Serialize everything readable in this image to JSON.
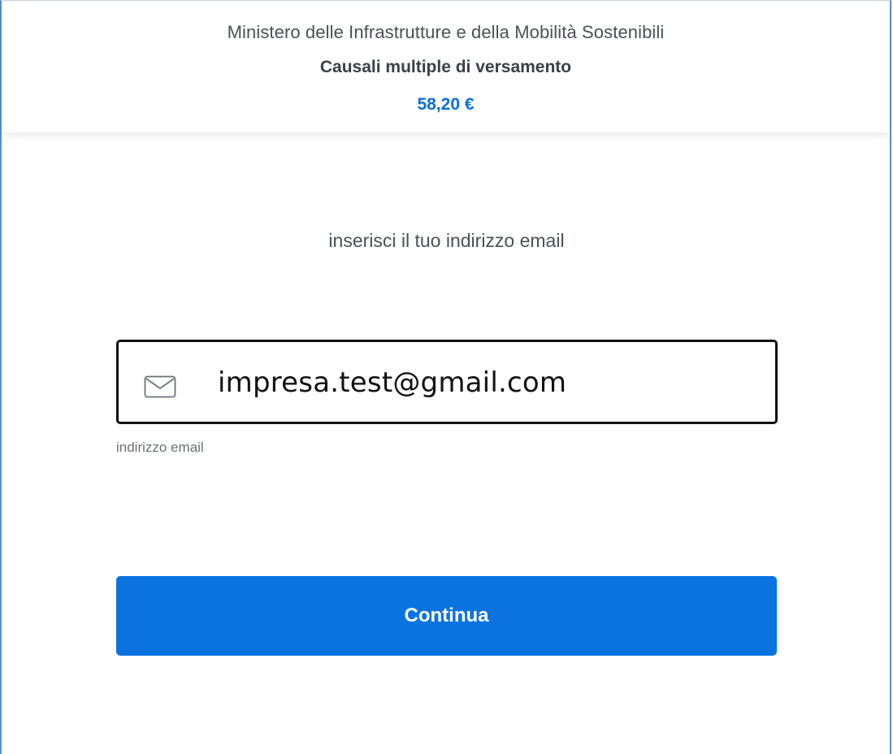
{
  "header": {
    "organization": "Ministero delle Infrastrutture e della Mobilità Sostenibili",
    "payment_subject": "Causali multiple di versamento",
    "amount": "58,20 €"
  },
  "email_step": {
    "prompt": "inserisci il tuo indirizzo email",
    "email_value": "impresa.test@gmail.com",
    "email_hint": "indirizzo email",
    "icon": "mail-icon"
  },
  "actions": {
    "continue_label": "Continua"
  },
  "colors": {
    "accent": "#0b73e0",
    "amount": "#0b6fd6",
    "text": "#4a5158"
  }
}
